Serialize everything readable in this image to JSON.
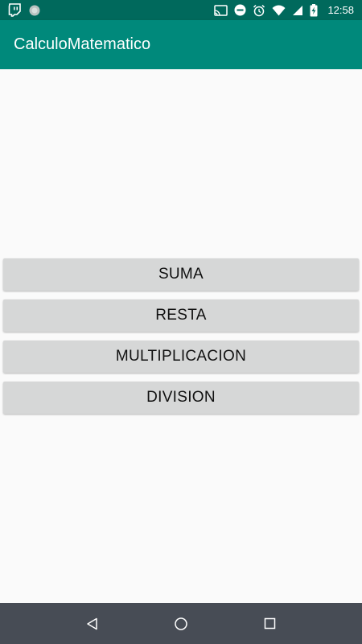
{
  "status_bar": {
    "time": "12:58",
    "icons": [
      "twitch-icon",
      "circle-notification-icon",
      "cast-icon",
      "do-not-disturb-icon",
      "alarm-icon",
      "wifi-icon",
      "signal-icon",
      "battery-charging-icon"
    ]
  },
  "app_bar": {
    "title": "CalculoMatematico",
    "color": "#00897b"
  },
  "main": {
    "buttons": [
      {
        "label": "SUMA"
      },
      {
        "label": "RESTA"
      },
      {
        "label": "MULTIPLICACION"
      },
      {
        "label": "DIVISION"
      }
    ]
  },
  "nav_bar": {
    "icons": [
      "back-icon",
      "home-icon",
      "recents-icon"
    ]
  },
  "colors": {
    "status_bar": "#00695c",
    "app_bar": "#00897b",
    "background": "#fafafa",
    "button": "#d6d7d7",
    "nav_bar": "#474c55"
  }
}
